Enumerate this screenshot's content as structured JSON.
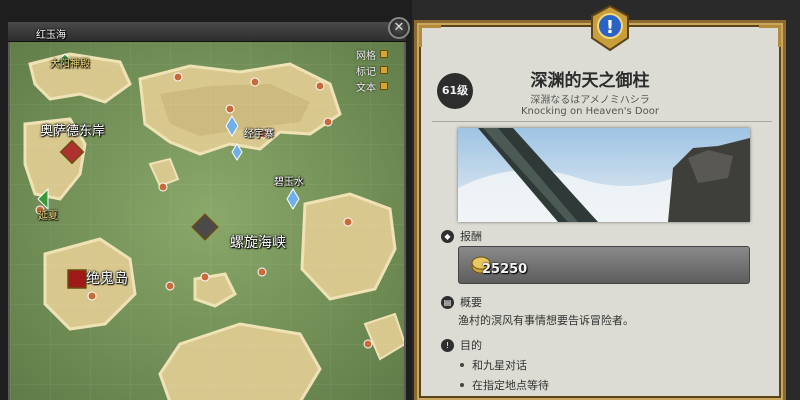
{
  "map": {
    "region_name": "红玉海",
    "toggles": [
      {
        "label": "网格",
        "checked": true
      },
      {
        "label": "标记",
        "checked": true
      },
      {
        "label": "文本",
        "checked": true
      }
    ],
    "labels": {
      "north_aetheryte": "大阳神殿",
      "east_coast": "奥萨德东岸",
      "tamamizu": "碧玉水",
      "kogane": "经宇寨",
      "spiral_strait": "螺旋海峡",
      "onokoro": "绝鬼岛",
      "southwest_exit": "延夏"
    },
    "close_icon": "close-icon"
  },
  "quest": {
    "level": "61级",
    "title": "深渊的天之御柱",
    "subtitle_jp": "深淵なるはアメノミハシラ",
    "subtitle_en": "Knocking on Heaven's Door",
    "reward_heading": "报酬",
    "reward_gil": "25250",
    "summary_heading": "概要",
    "summary_text": "渔村的溟风有事情想要告诉冒险者。",
    "objective_heading": "目的",
    "objectives": [
      "和九星对话",
      "在指定地点等待"
    ]
  },
  "colors": {
    "panel_bg": "#dcdcd4",
    "frame_gold": "#b48a3c",
    "map_land": "#d9c98f",
    "map_sea": "#7b9a60"
  }
}
